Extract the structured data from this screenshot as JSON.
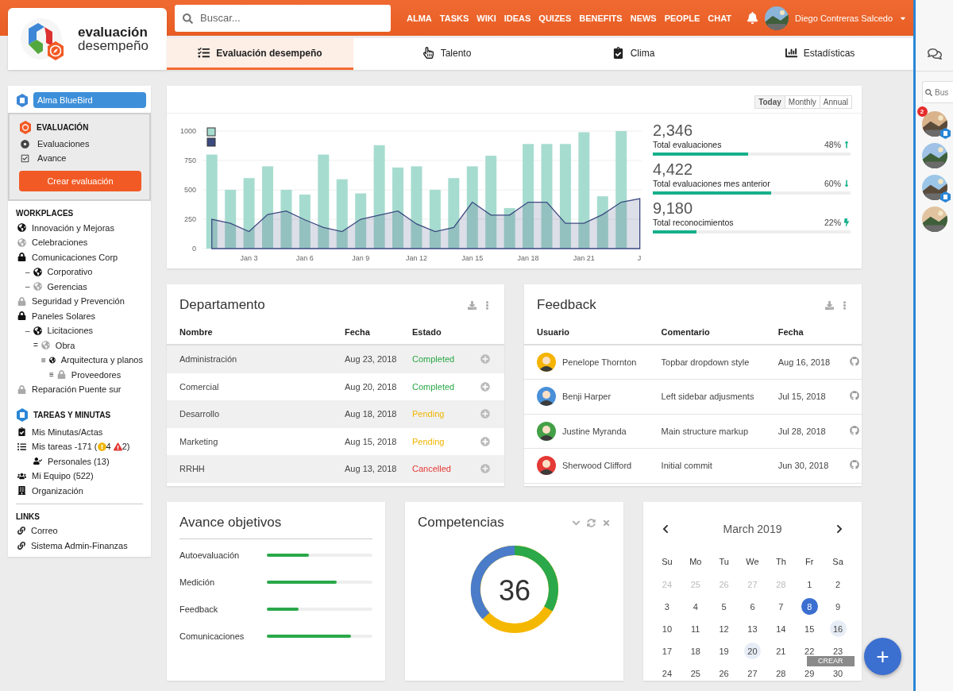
{
  "logo": {
    "line1": "evaluación",
    "line2": "desempeño"
  },
  "header": {
    "search": {
      "placeholder": "Buscar..."
    },
    "nav": [
      "ALMA",
      "TASKS",
      "WIKI",
      "IDEAS",
      "QUIZES",
      "BENEFITS",
      "NEWS",
      "PEOPLE",
      "CHAT"
    ],
    "user": {
      "name": "Diego Contreras Salcedo"
    }
  },
  "tabs": [
    {
      "label": "Evaluación desempeño",
      "selected": true
    },
    {
      "label": "Talento",
      "selected": false
    },
    {
      "label": "Clima",
      "selected": false
    },
    {
      "label": "Estadísticas",
      "selected": false
    }
  ],
  "sidebar": {
    "workspace": "Alma BlueBird",
    "section_title": "EVALUACIÓN",
    "menu": [
      {
        "label": "Evaluaciones",
        "kind": "radio"
      },
      {
        "label": "Avance",
        "kind": "check"
      }
    ],
    "create_button": "Crear evaluación",
    "workplaces": {
      "title": "WORKPLACES",
      "items": [
        {
          "label": "Innovación y Mejoras",
          "kind": "globe",
          "muted": false
        },
        {
          "label": "Celebraciones",
          "kind": "globe",
          "muted": true
        },
        {
          "label": "Comunicaciones Corp",
          "kind": "lock",
          "muted": false,
          "children": [
            {
              "marker": "–",
              "label": "Corporativo",
              "kind": "globe",
              "muted": false
            },
            {
              "marker": "–",
              "label": "Gerencias",
              "kind": "globe",
              "muted": true
            }
          ]
        },
        {
          "label": "Seguridad y Prevención",
          "kind": "lock",
          "muted": true
        },
        {
          "label": "Paneles Solares",
          "kind": "lock",
          "muted": false,
          "children": [
            {
              "marker": "–",
              "label": "Licitaciones",
              "kind": "globe",
              "muted": false,
              "children": [
                {
                  "marker": "=",
                  "label": "Obra",
                  "kind": "globe",
                  "muted": true,
                  "children": [
                    {
                      "marker": "≡",
                      "label": "Arquitectura y planos",
                      "kind": "globe",
                      "muted": false,
                      "children": [
                        {
                          "marker": "≡",
                          "label": "Proveedores",
                          "kind": "lock",
                          "muted": true
                        }
                      ]
                    }
                  ]
                }
              ]
            }
          ]
        },
        {
          "label": "Reparación Puente sur",
          "kind": "lock",
          "muted": true
        }
      ]
    },
    "tasks": {
      "title": "TAREAS Y MINUTAS",
      "items": [
        {
          "kind": "minutes",
          "label": "Mis Minutas/Actas"
        },
        {
          "kind": "tasks",
          "label": "Mis tareas -171 (",
          "warning": "4",
          "alert": "2)",
          "children": [
            {
              "kind": "personal",
              "label": "Personales (13)"
            }
          ]
        },
        {
          "kind": "team",
          "label": "Mi Equipo (522)"
        },
        {
          "kind": "org",
          "label": "Organización"
        }
      ]
    },
    "links": {
      "title": "LINKS",
      "items": [
        "Correo",
        "Sistema Admin-Finanzas"
      ]
    }
  },
  "overview": {
    "ranges": [
      {
        "label": "Today",
        "selected": true
      },
      {
        "label": "Monthly",
        "selected": false
      },
      {
        "label": "Annual",
        "selected": false
      }
    ],
    "chart_data": {
      "type": "bar",
      "categories": [
        null,
        null,
        "Jan 3",
        null,
        null,
        "Jan 6",
        null,
        null,
        "Jan 9",
        null,
        null,
        "Jan 12",
        null,
        null,
        "Jan 15",
        null,
        null,
        "Jan 18",
        null,
        null,
        "Jan 21",
        null,
        null,
        "J"
      ],
      "ylim": [
        0,
        1000
      ],
      "yticks": [
        0,
        250,
        500,
        750,
        1000
      ],
      "grid": true,
      "series": [
        {
          "color": "#a6dccf",
          "values": [
            800,
            500,
            600,
            700,
            500,
            460,
            800,
            590,
            470,
            880,
            690,
            700,
            500,
            600,
            700,
            790,
            345,
            890,
            890,
            890,
            990,
            445,
            1000,
            null
          ]
        },
        {
          "type": "area",
          "color": "#3d4a80",
          "values": [
            250,
            215,
            145,
            290,
            320,
            245,
            180,
            145,
            250,
            285,
            320,
            210,
            145,
            180,
            395,
            285,
            285,
            395,
            395,
            215,
            215,
            290,
            395,
            425
          ]
        }
      ]
    },
    "stats": [
      {
        "value": "2,346",
        "label": "Total evaluaciones",
        "percent": "48%",
        "kind": "up",
        "level": 0.48
      },
      {
        "value": "4,422",
        "label": "Total evaluaciones mes anterior",
        "percent": "60%",
        "kind": "down",
        "level": 0.6
      },
      {
        "value": "9,180",
        "label": "Total reconocimientos",
        "percent": "22%",
        "kind": "bolt",
        "level": 0.22
      }
    ]
  },
  "department": {
    "title": "Departamento",
    "columns": [
      "Nombre",
      "Fecha",
      "Estado"
    ],
    "rows": [
      {
        "name": "Administración",
        "date": "Aug 23, 2018",
        "status": "Completed",
        "kind": "completed"
      },
      {
        "name": "Comercial",
        "date": "Aug 20, 2018",
        "status": "Completed",
        "kind": "completed"
      },
      {
        "name": "Desarrollo",
        "date": "Aug 18, 2018",
        "status": "Pending",
        "kind": "pending"
      },
      {
        "name": "Marketing",
        "date": "Aug 15, 2018",
        "status": "Pending",
        "kind": "pending"
      },
      {
        "name": "RRHH",
        "date": "Aug 13, 2018",
        "status": "Cancelled",
        "kind": "cancelled"
      }
    ]
  },
  "feedback": {
    "title": "Feedback",
    "columns": [
      "Usuario",
      "Comentario",
      "Fecha"
    ],
    "rows": [
      {
        "user": "Penelope Thornton",
        "comment": "Topbar dropdown style",
        "date": "Aug 16, 2018",
        "color": "#f5b400"
      },
      {
        "user": "Benji Harper",
        "comment": "Left sidebar adjusments",
        "date": "Jul 15, 2018",
        "color": "#4a90d9"
      },
      {
        "user": "Justine Myranda",
        "comment": "Main structure markup",
        "date": "Jul 28, 2018",
        "color": "#43a047"
      },
      {
        "user": "Sherwood Clifford",
        "comment": "Initial commit",
        "date": "Jun 30, 2018",
        "color": "#e53935"
      }
    ]
  },
  "objectives": {
    "title": "Avance objetivos",
    "items": [
      {
        "label": "Autoevaluación",
        "level": 0.4
      },
      {
        "label": "Medición",
        "level": 0.66
      },
      {
        "label": "Feedback",
        "level": 0.3
      },
      {
        "label": "Comunicaciones",
        "level": 0.8
      }
    ]
  },
  "competencias": {
    "title": "Competencias",
    "value": "36"
  },
  "calendar": {
    "month": "March 2019",
    "weekdays": [
      "Su",
      "Mo",
      "Tu",
      "We",
      "Th",
      "Fr",
      "Sa"
    ],
    "weeks": [
      [
        {
          "d": "24",
          "muted": true,
          "selected": false,
          "marked": false
        },
        {
          "d": "25",
          "muted": true,
          "selected": false,
          "marked": false
        },
        {
          "d": "26",
          "muted": true,
          "selected": false,
          "marked": false
        },
        {
          "d": "27",
          "muted": true,
          "selected": false,
          "marked": false
        },
        {
          "d": "28",
          "muted": true,
          "selected": false,
          "marked": false
        },
        {
          "d": "1",
          "muted": false,
          "selected": false,
          "marked": false
        },
        {
          "d": "2",
          "muted": false,
          "selected": false,
          "marked": false
        }
      ],
      [
        {
          "d": "3",
          "muted": false,
          "selected": false,
          "marked": false
        },
        {
          "d": "4",
          "muted": false,
          "selected": false,
          "marked": false
        },
        {
          "d": "5",
          "muted": false,
          "selected": false,
          "marked": false
        },
        {
          "d": "6",
          "muted": false,
          "selected": false,
          "marked": false
        },
        {
          "d": "7",
          "muted": false,
          "selected": false,
          "marked": false
        },
        {
          "d": "8",
          "muted": false,
          "selected": true,
          "marked": false
        },
        {
          "d": "9",
          "muted": false,
          "selected": false,
          "marked": false
        }
      ],
      [
        {
          "d": "10",
          "muted": false,
          "selected": false,
          "marked": false
        },
        {
          "d": "11",
          "muted": false,
          "selected": false,
          "marked": false
        },
        {
          "d": "12",
          "muted": false,
          "selected": false,
          "marked": false
        },
        {
          "d": "13",
          "muted": false,
          "selected": false,
          "marked": false
        },
        {
          "d": "14",
          "muted": false,
          "selected": false,
          "marked": false
        },
        {
          "d": "15",
          "muted": false,
          "selected": false,
          "marked": false
        },
        {
          "d": "16",
          "muted": false,
          "selected": false,
          "marked": true
        }
      ],
      [
        {
          "d": "17",
          "muted": false,
          "selected": false,
          "marked": false
        },
        {
          "d": "18",
          "muted": false,
          "selected": false,
          "marked": false
        },
        {
          "d": "19",
          "muted": false,
          "selected": false,
          "marked": false
        },
        {
          "d": "20",
          "muted": false,
          "selected": false,
          "marked": true
        },
        {
          "d": "21",
          "muted": false,
          "selected": false,
          "marked": false
        },
        {
          "d": "22",
          "muted": false,
          "selected": false,
          "marked": false
        },
        {
          "d": "23",
          "muted": false,
          "selected": false,
          "marked": false
        }
      ],
      [
        {
          "d": "24",
          "muted": false,
          "selected": false,
          "marked": false
        },
        {
          "d": "25",
          "muted": false,
          "selected": false,
          "marked": false
        },
        {
          "d": "26",
          "muted": false,
          "selected": false,
          "marked": false
        },
        {
          "d": "27",
          "muted": false,
          "selected": false,
          "marked": false
        },
        {
          "d": "28",
          "muted": false,
          "selected": false,
          "marked": false
        },
        {
          "d": "29",
          "muted": false,
          "selected": false,
          "marked": false
        },
        {
          "d": "30",
          "muted": false,
          "selected": false,
          "marked": false
        }
      ]
    ]
  },
  "fab": {
    "label": "+",
    "tooltip": "CREAR"
  },
  "chat_rail": {
    "search": {
      "placeholder": "Bus"
    },
    "contacts": [
      {
        "badge": "2",
        "doc": true
      },
      {
        "doc": false
      },
      {
        "doc": true
      },
      {
        "doc": false
      }
    ]
  }
}
